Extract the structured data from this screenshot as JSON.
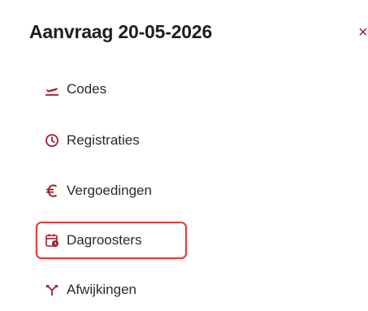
{
  "panel": {
    "title": "Aanvraag 20-05-2026",
    "close_label": "×"
  },
  "menu": {
    "items": [
      {
        "label": "Codes",
        "icon": "flight-icon"
      },
      {
        "label": "Registraties",
        "icon": "clock-icon"
      },
      {
        "label": "Vergoedingen",
        "icon": "euro-icon"
      },
      {
        "label": "Dagroosters",
        "icon": "calendar-clock-icon",
        "highlighted": true
      },
      {
        "label": "Afwijkingen",
        "icon": "split-arrow-icon"
      }
    ]
  },
  "colors": {
    "accent": "#a31c2e",
    "highlight_border": "#e23a3a",
    "text": "#2a2a2a"
  }
}
